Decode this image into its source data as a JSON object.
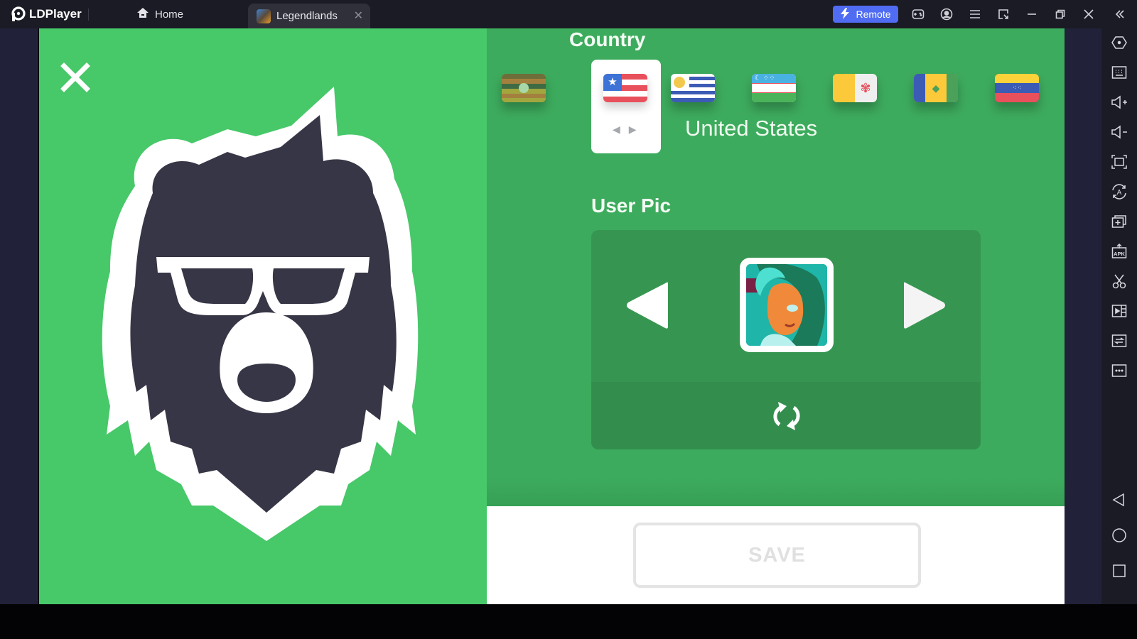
{
  "titlebar": {
    "app_name": "LDPlayer",
    "tabs": [
      {
        "label": "Home",
        "icon": "home-icon"
      },
      {
        "label": "Legendlands",
        "icon": "game-icon",
        "active": true
      }
    ],
    "remote_label": "Remote",
    "icons": [
      "gamepad-icon",
      "account-icon",
      "menu-icon",
      "resize-icon",
      "minimize-icon",
      "restore-icon",
      "close-icon",
      "collapse-sidebar-icon"
    ]
  },
  "sidebar": {
    "items": [
      {
        "name": "settings-icon"
      },
      {
        "name": "keyboard-icon"
      },
      {
        "name": "volume-up-icon"
      },
      {
        "name": "volume-down-icon"
      },
      {
        "name": "fullscreen-icon"
      },
      {
        "name": "sync-operation-icon",
        "glyph": "A"
      },
      {
        "name": "multi-instance-icon"
      },
      {
        "name": "apk-install-icon",
        "glyph": "APK"
      },
      {
        "name": "scissors-icon"
      },
      {
        "name": "record-video-icon"
      },
      {
        "name": "sync-icon"
      },
      {
        "name": "more-icon"
      }
    ],
    "nav": [
      "back-icon",
      "home-circle-icon",
      "recent-apps-icon"
    ]
  },
  "game": {
    "colors": {
      "left_bg": "#47c869",
      "right_bg": "#3dab5d",
      "pic_box_bg": "#369651",
      "bear_dark": "#363646"
    },
    "country": {
      "title": "Country",
      "selected": "United States",
      "flags": [
        {
          "name": "flag-uganda-like",
          "country": ""
        },
        {
          "name": "flag-united-states",
          "country": "United States",
          "selected": true
        },
        {
          "name": "flag-uruguay",
          "country": "Uruguay"
        },
        {
          "name": "flag-uzbekistan",
          "country": "Uzbekistan"
        },
        {
          "name": "flag-vatican",
          "country": "Vatican"
        },
        {
          "name": "flag-saint-vincent",
          "country": "Saint Vincent and the Grenadines"
        },
        {
          "name": "flag-venezuela",
          "country": "Venezuela"
        }
      ],
      "arrows": {
        "left": "◀",
        "right": "▶"
      }
    },
    "user_pic": {
      "title": "User Pic"
    },
    "save_label": "SAVE"
  }
}
